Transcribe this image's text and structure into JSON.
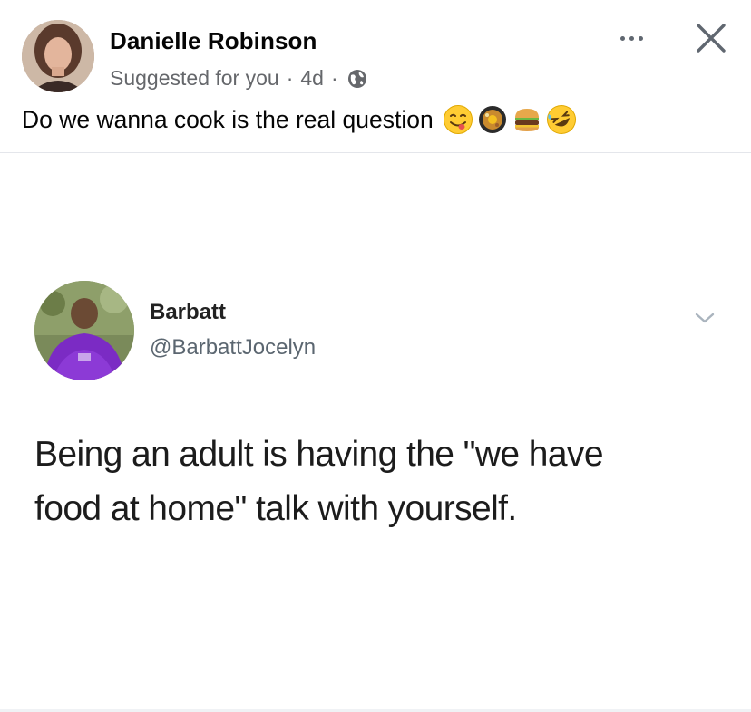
{
  "post": {
    "author_name": "Danielle Robinson",
    "suggested_label": "Suggested for you",
    "separator": "·",
    "time": "4d",
    "audience_icon": "globe-icon",
    "caption": "Do we wanna cook is the real question",
    "caption_emojis": [
      "yum-face-emoji",
      "cooking-pan-emoji",
      "hamburger-emoji",
      "rofl-emoji"
    ],
    "actions": {
      "more_icon": "more-dots-icon",
      "close_icon": "close-icon"
    }
  },
  "tweet": {
    "name": "Barbatt",
    "handle": "@BarbattJocelyn",
    "text_line1": "Being an adult is having the \"we have",
    "text_line2": "food at home\" talk with yourself.",
    "menu_icon": "chevron-down-icon"
  },
  "colors": {
    "primary_text": "#050505",
    "secondary_text": "#65676b",
    "divider": "#e4e6eb",
    "tweet_handle": "#5b6670"
  }
}
